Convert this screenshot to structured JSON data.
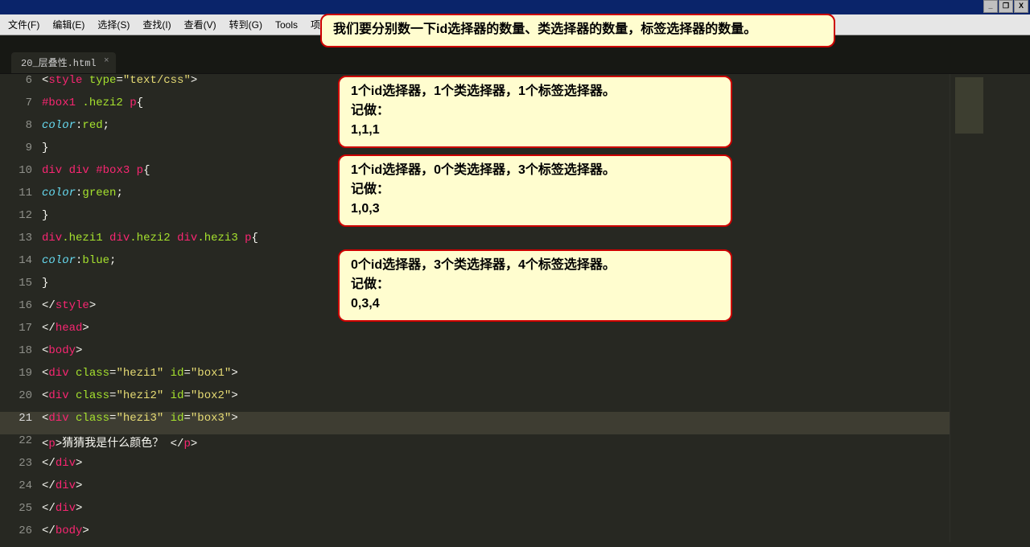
{
  "window": {
    "minimize": "_",
    "maximize": "❐",
    "close": "X"
  },
  "menubar": {
    "items": [
      "文件(F)",
      "编辑(E)",
      "选择(S)",
      "查找(I)",
      "查看(V)",
      "转到(G)",
      "Tools",
      "项目(P)"
    ]
  },
  "tab": {
    "name": "20_层叠性.html",
    "close": "×"
  },
  "lines": {
    "l6": {
      "num": "6"
    },
    "l7": {
      "num": "7"
    },
    "l8": {
      "num": "8"
    },
    "l9": {
      "num": "9"
    },
    "l10": {
      "num": "10"
    },
    "l11": {
      "num": "11"
    },
    "l12": {
      "num": "12"
    },
    "l13": {
      "num": "13"
    },
    "l14": {
      "num": "14"
    },
    "l15": {
      "num": "15"
    },
    "l16": {
      "num": "16"
    },
    "l17": {
      "num": "17"
    },
    "l18": {
      "num": "18"
    },
    "l19": {
      "num": "19"
    },
    "l20": {
      "num": "20"
    },
    "l21": {
      "num": "21"
    },
    "l22": {
      "num": "22"
    },
    "l23": {
      "num": "23"
    },
    "l24": {
      "num": "24"
    },
    "l25": {
      "num": "25"
    },
    "l26": {
      "num": "26"
    }
  },
  "code_tokens": {
    "style": "style",
    "type": "type",
    "textcss": "\"text/css\"",
    "box1": "#box1",
    "hezi2c": ".hezi2",
    "p": "p",
    "color": "color",
    "red": "red",
    "green": "green",
    "blue": "blue",
    "div": "div",
    "box3": "#box3",
    "hezi1c": ".hezi1",
    "hezi3c": ".hezi3",
    "head": "head",
    "body": "body",
    "class": "class",
    "id": "id",
    "hezi1s": "\"hezi1\"",
    "box1s": "\"box1\"",
    "hezi2s": "\"hezi2\"",
    "box2s": "\"box2\"",
    "hezi3s": "\"hezi3\"",
    "box3s": "\"box3\"",
    "ptext": "猜猜我是什么颜色？ "
  },
  "callouts": {
    "head": "我们要分别数一下id选择器的数量、类选择器的数量，标签选择器的数量。",
    "c1a": "1个id选择器，1个类选择器，1个标签选择器。",
    "c1b": "记做：",
    "c1c": "1,1,1",
    "c2a": "1个id选择器，0个类选择器，3个标签选择器。",
    "c2b": "记做：",
    "c2c": "1,0,3",
    "c3a": "0个id选择器，3个类选择器，4个标签选择器。",
    "c3b": "记做：",
    "c3c": "0,3,4"
  }
}
